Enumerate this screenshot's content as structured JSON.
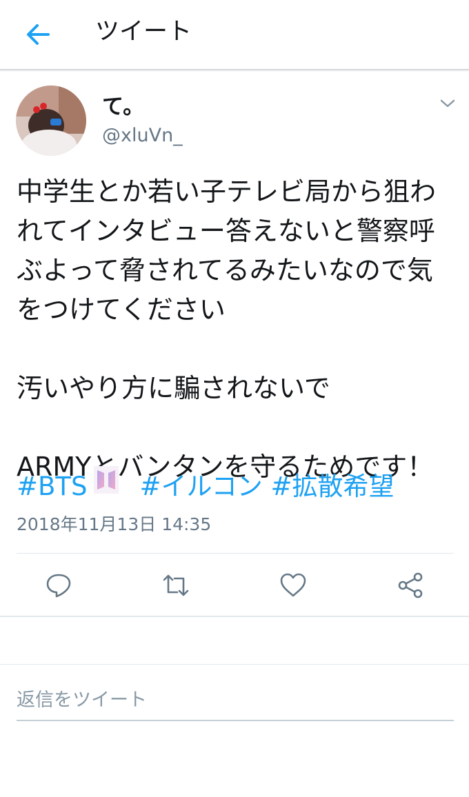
{
  "header": {
    "title": "ツイート"
  },
  "tweet": {
    "display_name": "て。",
    "handle": "@xluVn_",
    "body": "中学生とか若い子テレビ局から狙われてインタビュー答えないと警察呼ぶよって脅されてるみたいなので気をつけてください\n\n汚いやり方に騙されないで\n\nARMYとバンタンを守るためです！",
    "hashtags": [
      "#BTS",
      "#イルコン",
      "#拡散希望"
    ],
    "timestamp": "2018年11月13日 14:35"
  },
  "icons": {
    "back": "back-arrow-icon",
    "caret": "chevron-down-icon",
    "reply": "reply-icon",
    "retweet": "retweet-icon",
    "like": "heart-icon",
    "share": "share-icon",
    "bts_logo": "bts-logo-icon"
  },
  "colors": {
    "accent": "#1da1f2",
    "secondary_text": "#657786",
    "icon": "#657786"
  },
  "reply": {
    "placeholder": "返信をツイート"
  }
}
